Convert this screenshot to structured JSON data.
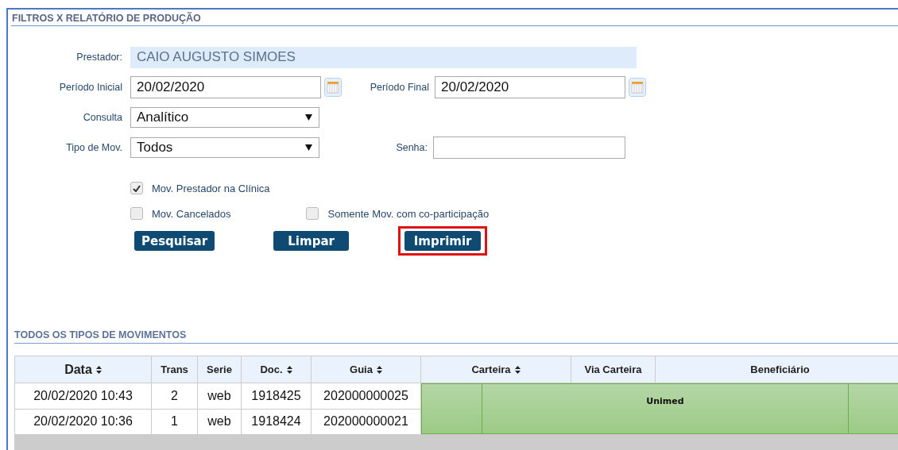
{
  "panel": {
    "title": "FILTROS X RELATÓRIO DE PRODUÇÃO"
  },
  "form": {
    "prestador": {
      "label": "Prestador:",
      "value": "CAIO AUGUSTO SIMOES"
    },
    "periodo_inicial": {
      "label": "Período Inicial",
      "value": "20/02/2020"
    },
    "periodo_final": {
      "label": "Período Final",
      "value": "20/02/2020"
    },
    "consulta": {
      "label": "Consulta",
      "value": "Analítico"
    },
    "tipo_mov": {
      "label": "Tipo de Mov.",
      "value": "Todos"
    },
    "senha": {
      "label": "Senha:"
    },
    "checkboxes": [
      {
        "label": "Mov. Prestador na Clínica",
        "checked": true
      },
      {
        "label": "Mov. Cancelados",
        "checked": false
      },
      {
        "label": "Somente Mov. com co-participação",
        "checked": false
      }
    ],
    "buttons": [
      {
        "label": "Pesquisar",
        "highlighted": false
      },
      {
        "label": "Limpar",
        "highlighted": false
      },
      {
        "label": "Imprimir",
        "highlighted": true
      }
    ]
  },
  "table": {
    "title": "TODOS OS TIPOS DE MOVIMENTOS",
    "columns": [
      {
        "label": "Data",
        "sortable": true
      },
      {
        "label": "Trans",
        "sortable": false
      },
      {
        "label": "Serie",
        "sortable": false
      },
      {
        "label": "Doc.",
        "sortable": true
      },
      {
        "label": "Guia",
        "sortable": true
      },
      {
        "label": "Carteira",
        "sortable": true
      },
      {
        "label": "Via Carteira",
        "sortable": false
      },
      {
        "label": "Beneficiário",
        "sortable": false
      }
    ],
    "rows": [
      [
        "20/02/2020 10:43",
        "2",
        "web",
        "1918425",
        "202000000025"
      ],
      [
        "20/02/2020 10:36",
        "1",
        "web",
        "1918424",
        "202000000021"
      ]
    ],
    "overlay": {
      "label": "Unimed"
    }
  }
}
